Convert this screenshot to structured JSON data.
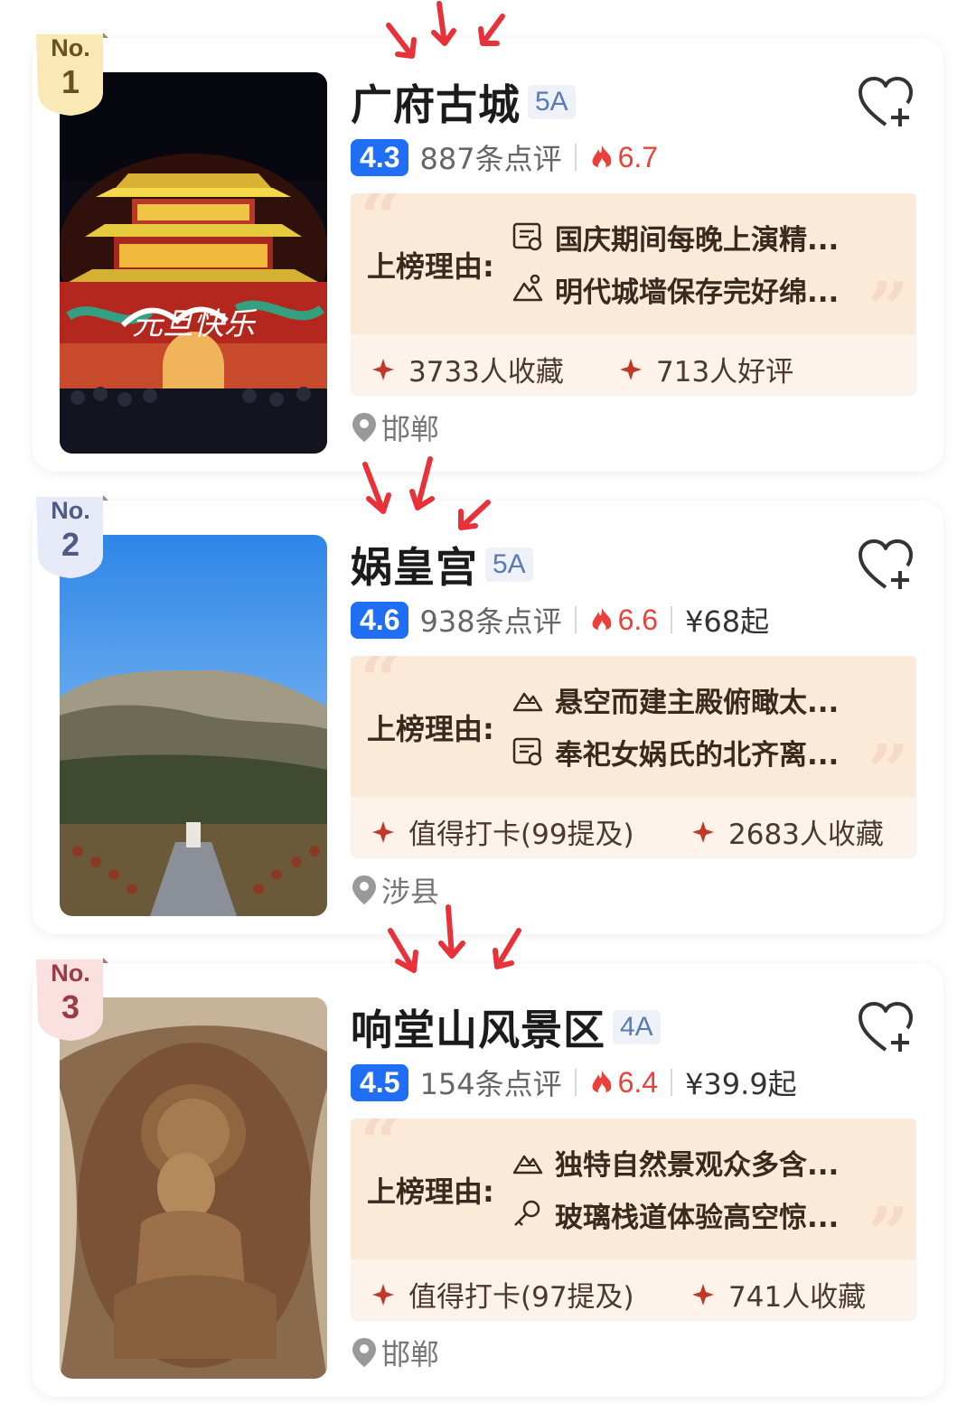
{
  "cards": [
    {
      "badge": {
        "no": "No.",
        "rank": "1"
      },
      "title": "广府古城",
      "grade": "5A",
      "score": "4.3",
      "reviews": "887条点评",
      "heat": "6.7",
      "price": "",
      "reason_label": "上榜理由:",
      "reasons": [
        "国庆期间每晚上演精...",
        "明代城墙保存完好绵..."
      ],
      "stats": [
        "3733人收藏",
        "713人好评"
      ],
      "location": "邯郸",
      "image_banner": "元旦快乐"
    },
    {
      "badge": {
        "no": "No.",
        "rank": "2"
      },
      "title": "娲皇宫",
      "grade": "5A",
      "score": "4.6",
      "reviews": "938条点评",
      "heat": "6.6",
      "price": "¥68起",
      "reason_label": "上榜理由:",
      "reasons": [
        "悬空而建主殿俯瞰太...",
        "奉祀女娲氏的北齐离..."
      ],
      "stats": [
        "值得打卡(99提及)",
        "2683人收藏"
      ],
      "location": "涉县"
    },
    {
      "badge": {
        "no": "No.",
        "rank": "3"
      },
      "title": "响堂山风景区",
      "grade": "4A",
      "score": "4.5",
      "reviews": "154条点评",
      "heat": "6.4",
      "price": "¥39.9起",
      "reason_label": "上榜理由:",
      "reasons": [
        "独特自然景观众多含...",
        "玻璃栈道体验高空惊..."
      ],
      "stats": [
        "值得打卡(97提及)",
        "741人收藏"
      ],
      "location": "邯郸"
    }
  ],
  "colors": {
    "score_bg": "#1f6ef5",
    "heat": "#e8423a",
    "reason_bg": "#fcead9",
    "annotation_arrow": "#e8323a"
  },
  "icons": [
    "favorite-add-icon",
    "fire-icon",
    "sparkle-icon",
    "location-pin-icon",
    "ticket-icon",
    "mountain-icon",
    "key-icon"
  ]
}
